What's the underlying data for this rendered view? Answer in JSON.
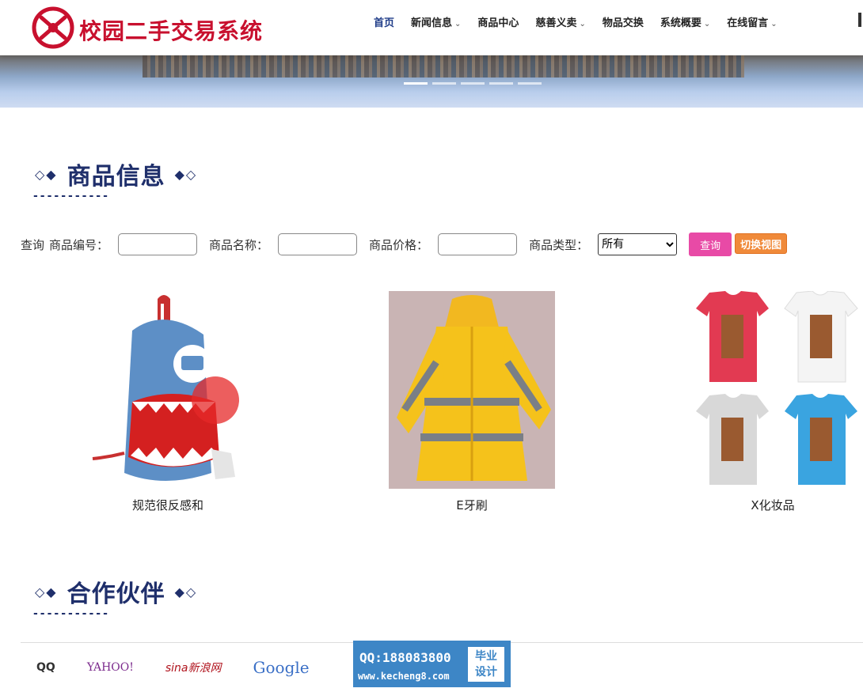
{
  "header": {
    "site_name": "校园二手交易系统",
    "nav": [
      {
        "label": "首页",
        "active": true,
        "dropdown": false
      },
      {
        "label": "新闻信息",
        "active": false,
        "dropdown": true
      },
      {
        "label": "商品中心",
        "active": false,
        "dropdown": false
      },
      {
        "label": "慈善义卖",
        "active": false,
        "dropdown": true
      },
      {
        "label": "物品交换",
        "active": false,
        "dropdown": false
      },
      {
        "label": "系统概要",
        "active": false,
        "dropdown": true
      },
      {
        "label": "在线留言",
        "active": false,
        "dropdown": true
      }
    ]
  },
  "banner": {
    "slides": 5,
    "active_slide": 1
  },
  "goods_section": {
    "title": "商品信息",
    "deco_left": "◇◆",
    "deco_right": "◆◇",
    "underline": "-----------"
  },
  "search": {
    "label_query": "查询",
    "label_code": "商品编号：",
    "label_name": "商品名称：",
    "label_price": "商品价格：",
    "label_type": "商品类型：",
    "code_value": "",
    "name_value": "",
    "price_value": "",
    "type_selected": "所有",
    "query_button": "查询",
    "switch_button": "切换视图"
  },
  "products": [
    {
      "name": "规范很反感和",
      "image": "backpack"
    },
    {
      "name": "E牙刷",
      "image": "raincoat"
    },
    {
      "name": "X化妆品",
      "image": "tshirts"
    }
  ],
  "partners_section": {
    "title": "合作伙伴",
    "deco_left": "◇◆",
    "deco_right": "◆◇",
    "underline": "-----------",
    "logos": [
      "QQ",
      "YAHOO!",
      "sina新浪网",
      "Google"
    ]
  },
  "watermark": {
    "qq": "QQ:188083800",
    "url": "www.kecheng8.com",
    "badge_line1": "毕业",
    "badge_line2": "设计"
  },
  "colors": {
    "brand_red": "#c8102e",
    "title_navy": "#1f2f6b",
    "query_pink": "#e84aa6",
    "switch_orange": "#f08a3a",
    "watermark_blue": "#3d86c6"
  }
}
